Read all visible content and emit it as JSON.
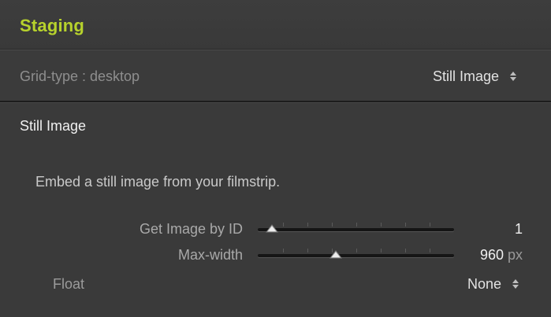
{
  "panel": {
    "title": "Staging"
  },
  "grid": {
    "label": "Grid-type : desktop",
    "mode_value": "Still Image"
  },
  "section": {
    "title": "Still Image",
    "description": "Embed a still image from your filmstrip."
  },
  "controls": {
    "image_id": {
      "label": "Get Image by ID",
      "value": "1",
      "level": 0.04
    },
    "max_width": {
      "label": "Max-width",
      "value": "960",
      "unit": "px",
      "level": 0.39
    },
    "float": {
      "label": "Float",
      "value": "None"
    }
  },
  "colors": {
    "accent": "#b7d22c",
    "panel_bg": "#3a3a3a",
    "track": "#151515"
  },
  "icons": {
    "select_arrows": "updown-chevron-icon",
    "slider_thumb": "triangle-thumb-icon"
  }
}
